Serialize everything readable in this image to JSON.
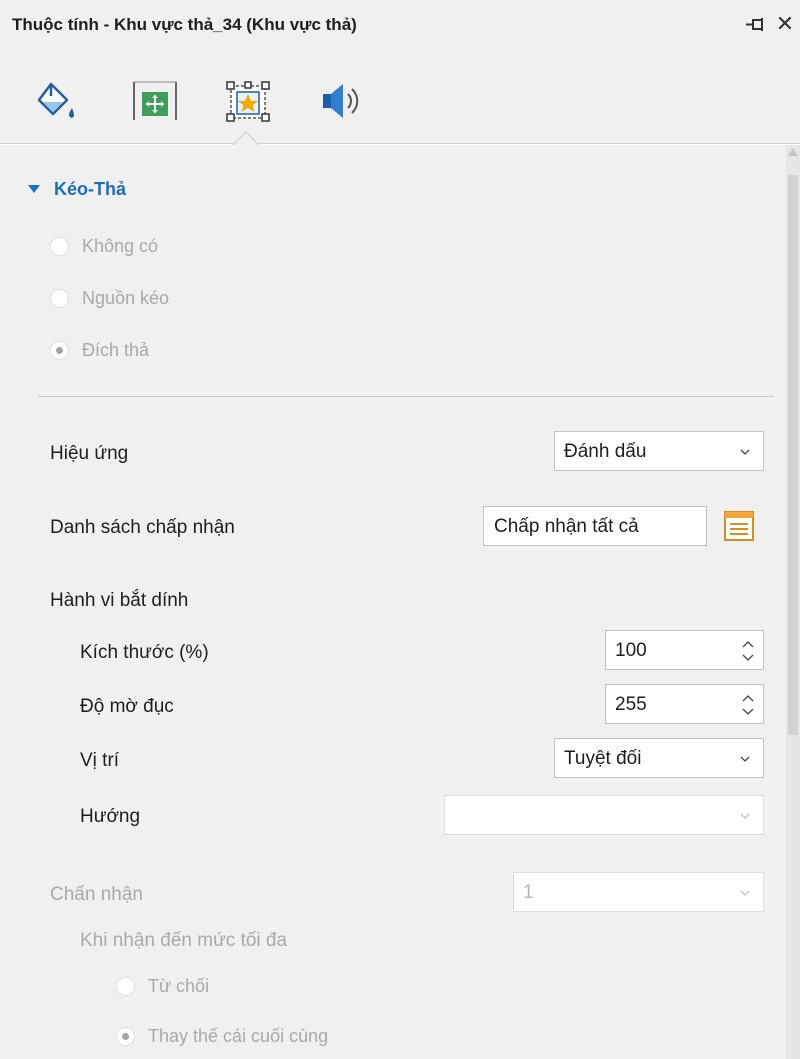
{
  "window": {
    "title": "Thuộc tính - Khu vực thả_34 (Khu vực thả)"
  },
  "toolbar": {
    "tabs": [
      {
        "icon": "paint-bucket-icon",
        "selected": false
      },
      {
        "icon": "move-frame-icon",
        "selected": false
      },
      {
        "icon": "star-frame-icon",
        "selected": true
      },
      {
        "icon": "speaker-icon",
        "selected": false
      }
    ]
  },
  "colors": {
    "accent": "#1a6ebf",
    "panel": "#f0f0f0",
    "disabled_text": "#a9a9a9"
  },
  "drag_drop": {
    "title": "Kéo-Thả",
    "options": [
      {
        "label": "Không có",
        "checked": false
      },
      {
        "label": "Nguồn kéo",
        "checked": false
      },
      {
        "label": "Đích thả",
        "checked": true
      }
    ]
  },
  "effect": {
    "label": "Hiệu ứng",
    "value": "Đánh dấu"
  },
  "accept_list": {
    "label": "Danh sách chấp nhận",
    "value": "Chấp nhận tất cả"
  },
  "snap": {
    "label": "Hành vi bắt dính",
    "size_label": "Kích thước (%)",
    "size_value": "100",
    "opacity_label": "Độ mờ đục",
    "opacity_value": "255",
    "position_label": "Vị trí",
    "position_value": "Tuyệt đối",
    "direction_label": "Hướng",
    "direction_value": ""
  },
  "accept": {
    "label": "Chấn nhận",
    "value": "1",
    "max_label": "Khi nhận đến mức tối đa",
    "options": [
      {
        "label": "Từ chối",
        "checked": false
      },
      {
        "label": "Thay thế cái cuối cùng",
        "checked": true
      }
    ]
  }
}
